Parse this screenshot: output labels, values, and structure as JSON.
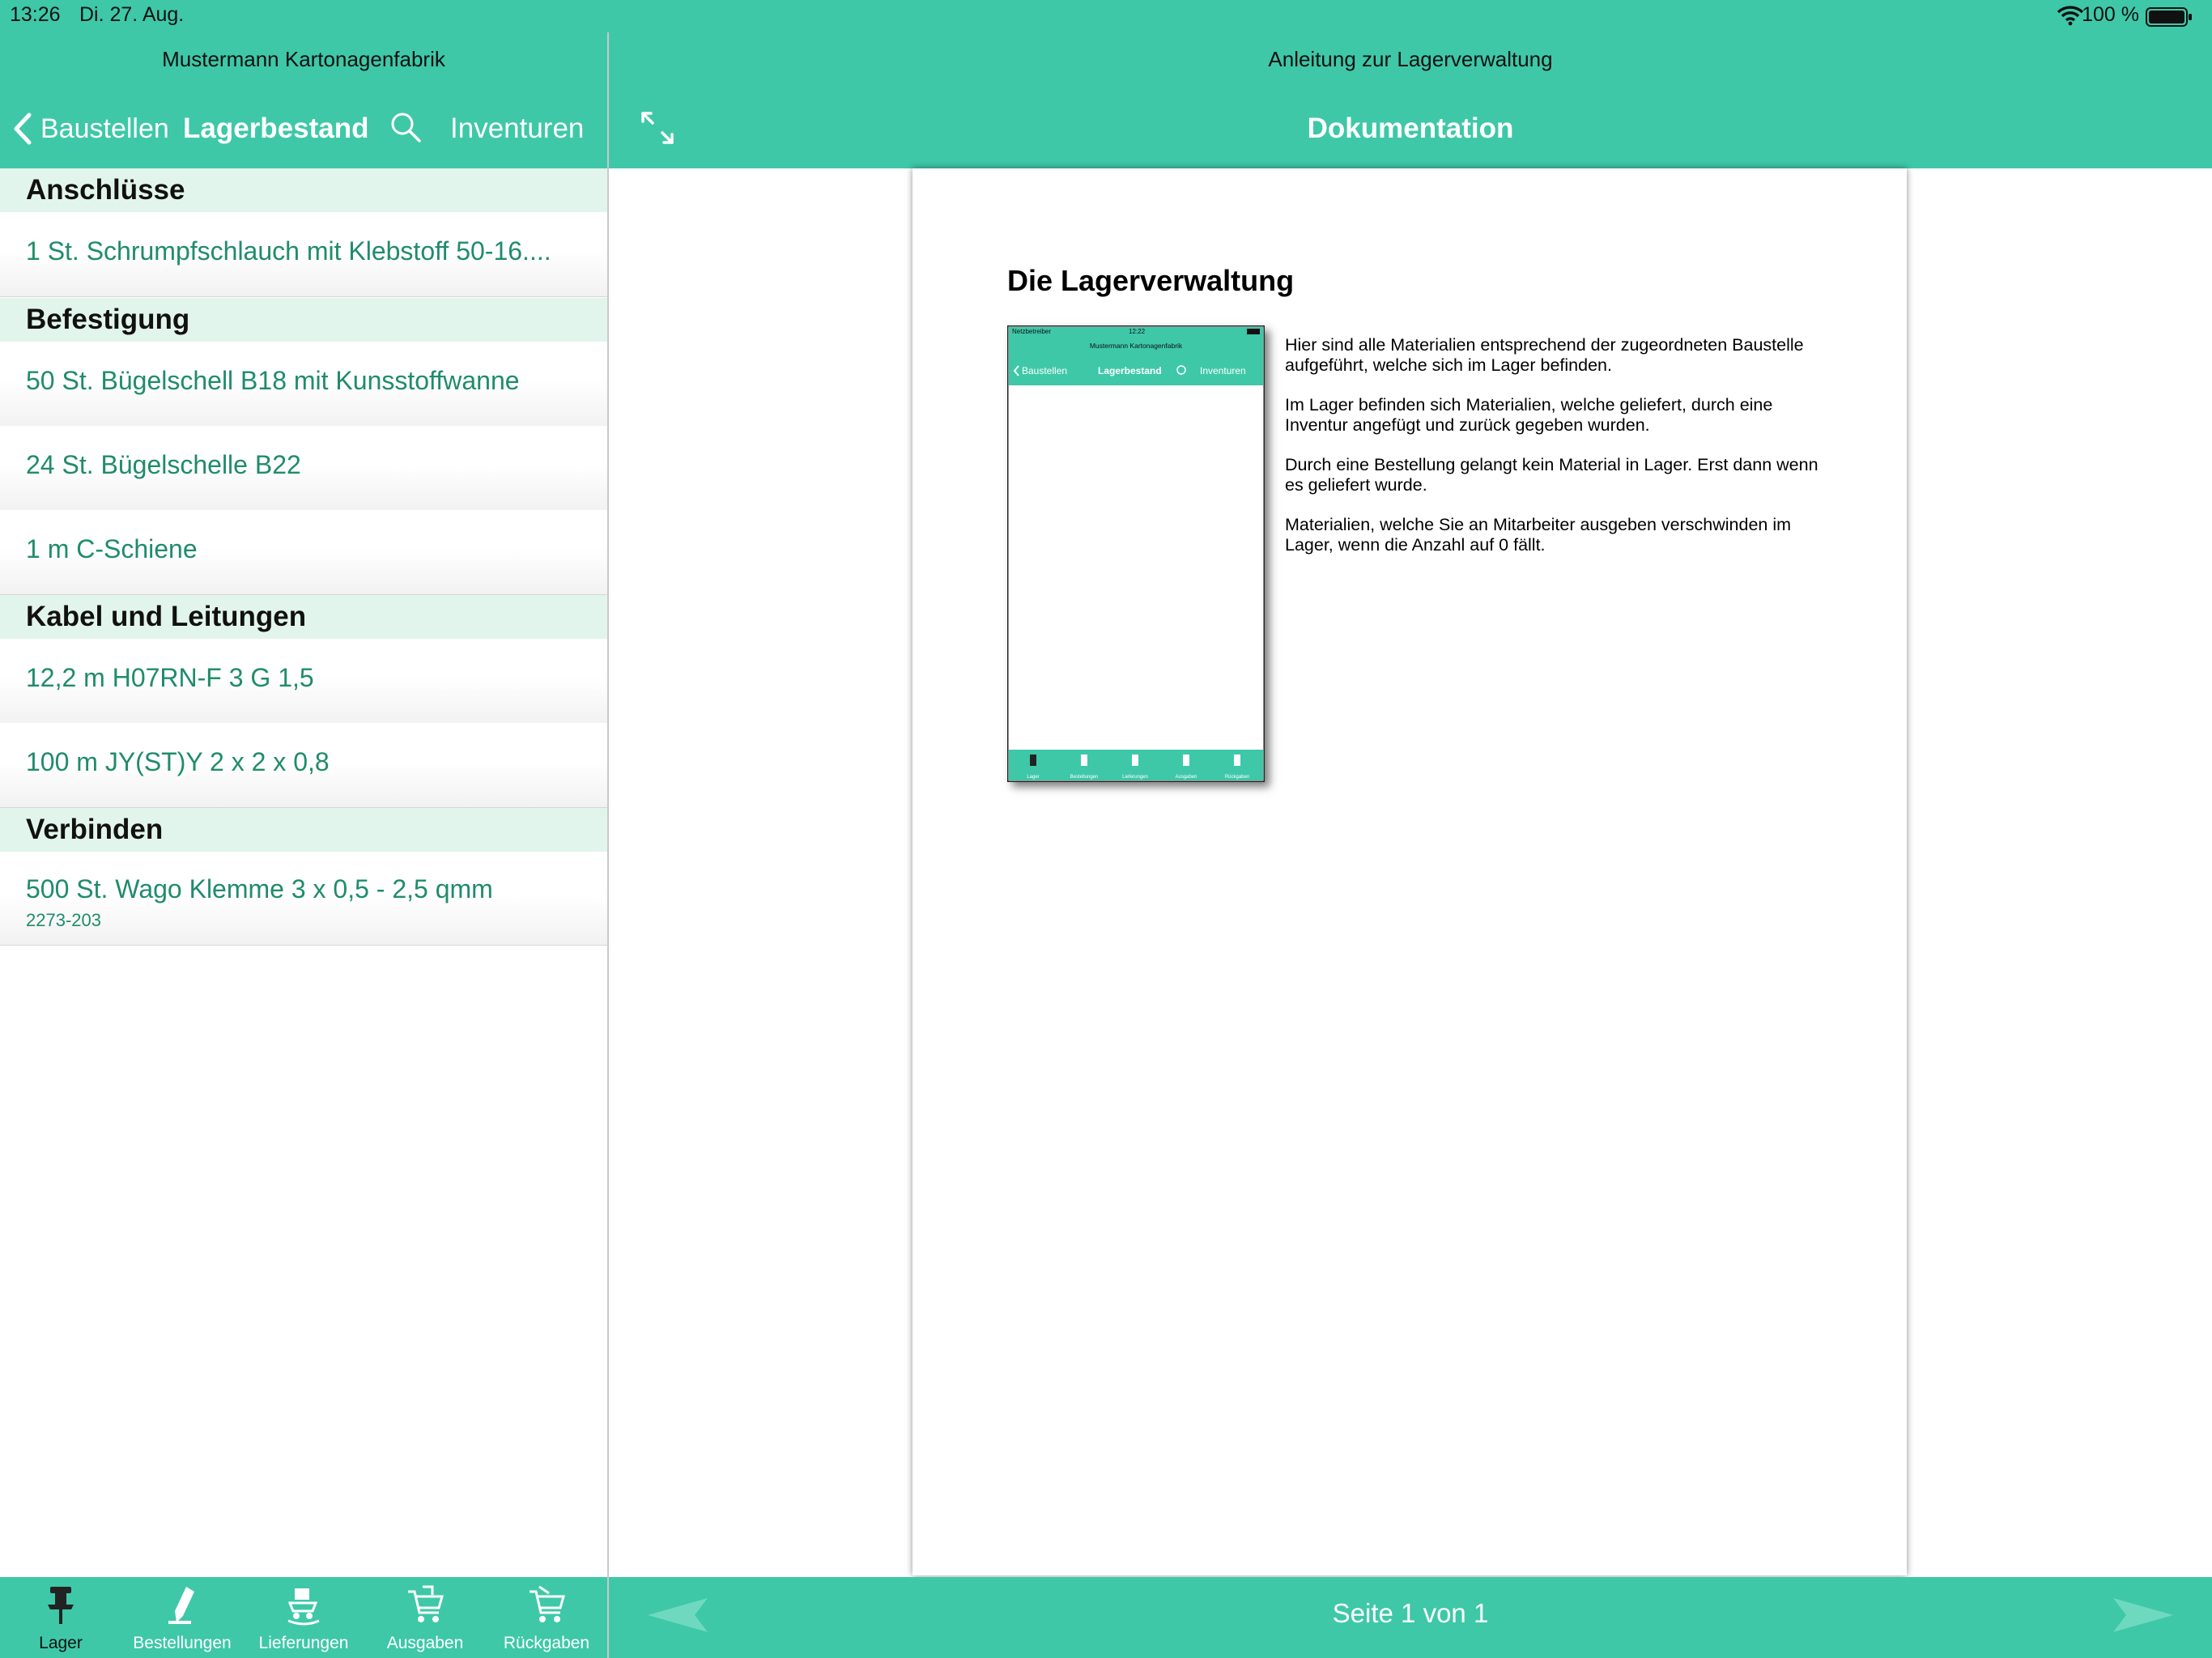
{
  "status": {
    "time": "13:26",
    "date": "Di. 27. Aug.",
    "battery": "100 %"
  },
  "left_nav": {
    "company": "Mustermann Kartonagenfabrik",
    "back_label": "Baustellen",
    "title": "Lagerbestand",
    "right_button": "Inventuren"
  },
  "right_nav": {
    "subtitle": "Anleitung zur Lagerverwaltung",
    "title": "Dokumentation"
  },
  "sections": [
    {
      "header": "Anschlüsse",
      "items": [
        {
          "label": "1 St. Schrumpfschlauch mit Klebstoff 50-16...."
        }
      ]
    },
    {
      "header": "Befestigung",
      "items": [
        {
          "label": "50 St. Bügelschell B18 mit Kunsstoffwanne"
        },
        {
          "label": "24 St. Bügelschelle B22"
        },
        {
          "label": "1 m C-Schiene"
        }
      ]
    },
    {
      "header": "Kabel und Leitungen",
      "items": [
        {
          "label": "12,2 m H07RN-F 3 G 1,5"
        },
        {
          "label": "100 m JY(ST)Y 2 x 2 x 0,8"
        }
      ]
    },
    {
      "header": "Verbinden",
      "items": [
        {
          "label": "500 St. Wago Klemme 3 x 0,5 - 2,5 qmm",
          "sub": "2273-203"
        }
      ]
    }
  ],
  "tabs": [
    {
      "label": "Lager",
      "icon": "pin-icon",
      "active": true
    },
    {
      "label": "Bestellungen",
      "icon": "pencil-icon"
    },
    {
      "label": "Lieferungen",
      "icon": "delivery-icon"
    },
    {
      "label": "Ausgaben",
      "icon": "cart-out-icon"
    },
    {
      "label": "Rückgaben",
      "icon": "cart-return-icon"
    }
  ],
  "document": {
    "heading": "Die Lagerverwaltung",
    "paragraphs": [
      "Hier sind alle Materialien entsprechend der zugeordneten Baustelle aufgeführt, welche sich im Lager befinden.",
      "Im Lager befinden sich Materialien, welche geliefert, durch eine Inventur angefügt und zurück gegeben wurden.",
      "Durch eine Bestellung gelangt kein Material in Lager. Erst dann wenn es geliefert wurde.",
      "Materialien, welche Sie an Mitarbeiter ausgeben verschwinden im Lager, wenn die Anzahl auf 0 fällt."
    ],
    "mini": {
      "carrier": "Netzbetreiber",
      "time": "12:22",
      "company": "Mustermann Kartonagenfabrik",
      "back": "Baustellen",
      "title": "Lagerbestand",
      "right": "Inventuren",
      "tabs": [
        "Lager",
        "Bestellungen",
        "Lieferungen",
        "Ausgaben",
        "Rückgaben"
      ]
    }
  },
  "pager": {
    "label": "Seite 1 von 1"
  },
  "colors": {
    "accent": "#3ec8a8",
    "section_bg": "#e2f5ec",
    "item_text": "#1f8c6a"
  }
}
